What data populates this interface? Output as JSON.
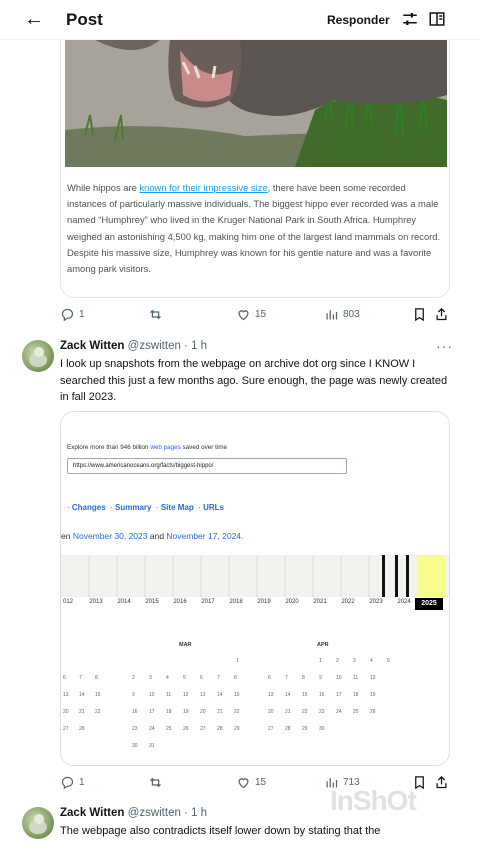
{
  "header": {
    "back_icon": "arrow-left-icon",
    "title": "Post",
    "reply_label": "Responder"
  },
  "quoted_article": {
    "text_before_link": "While hippos are ",
    "link_text": "known for their impressive size",
    "text_after_link": ", there have been some recorded instances of particularly massive individuals. The biggest hippo ever recorded was a male named “Humphrey” who lived in the Kruger National Park in South Africa. Humphrey weighed an astonishing 4,500 kg, making him one of the largest land mammals on record. Despite his massive size, Humphrey was known for his gentle nature and was a favorite among park visitors."
  },
  "actions_1": {
    "replies": "1",
    "retweets": "",
    "likes": "15",
    "views": "803"
  },
  "post_2": {
    "name": "Zack Witten",
    "handle": "@zswitten · 1 h",
    "text": "I look up snapshots from the webpage on archive dot org since I KNOW I searched this just a few months ago. Sure enough, the page was newly created in fall 2023."
  },
  "wayback": {
    "caption_prefix": "Explore more than 946 billion ",
    "caption_link": "web pages",
    "caption_suffix": " saved over time",
    "input_value": "https://www.americanoceans.org/facts/biggest-hippo/",
    "nav": [
      "Changes",
      "Summary",
      "Site Map",
      "URLs"
    ],
    "range_prefix": "en ",
    "range_start": "November 30, 2023",
    "range_mid": " and ",
    "range_end": "November 17, 2024.",
    "years": [
      "012",
      "2013",
      "2014",
      "2015",
      "2016",
      "2017",
      "2018",
      "2019",
      "2020",
      "2021",
      "2022",
      "2023",
      "2024",
      "2025"
    ],
    "selected_year": "2025",
    "month_left": "MAR",
    "month_right": "APR"
  },
  "actions_2": {
    "replies": "1",
    "retweets": "",
    "likes": "15",
    "views": "713"
  },
  "post_3": {
    "name": "Zack Witten",
    "handle": "@zswitten · 1 h",
    "text": "The webpage also contradicts itself lower down by stating that the"
  },
  "watermark": "InShOt",
  "colors": {
    "link": "#1d9bf0",
    "histogram_highlight": "#f6fb8a",
    "text_muted": "#536471"
  }
}
